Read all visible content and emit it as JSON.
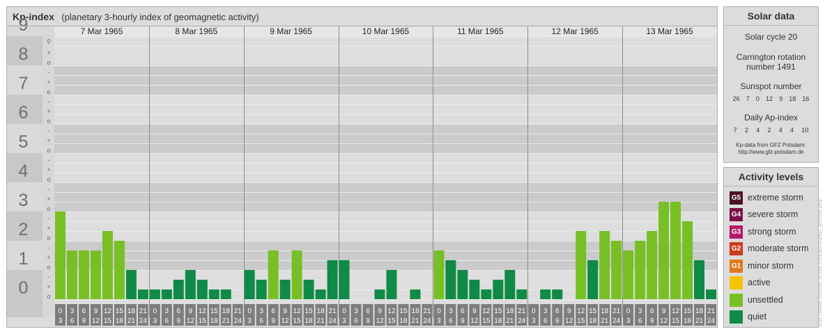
{
  "header": {
    "title": "Kp-index",
    "subtitle": "(planetary 3-hourly index of geomagnetic activity)"
  },
  "chart_data": {
    "type": "bar",
    "y_levels": [
      "0",
      "1",
      "2",
      "3",
      "4",
      "5",
      "6",
      "7",
      "8",
      "9"
    ],
    "y_minor": [
      "o",
      "+",
      "-"
    ],
    "ylim": [
      0,
      9
    ],
    "days": [
      {
        "date": "7 Mar 1965",
        "kp": [
          3.0,
          1.667,
          1.667,
          1.667,
          2.333,
          2.0,
          1.0,
          0.333
        ]
      },
      {
        "date": "8 Mar 1965",
        "kp": [
          0.333,
          0.333,
          0.667,
          1.0,
          0.667,
          0.333,
          0.333,
          0.0
        ]
      },
      {
        "date": "9 Mar 1965",
        "kp": [
          1.0,
          0.667,
          1.667,
          0.667,
          1.667,
          0.667,
          0.333,
          1.333
        ]
      },
      {
        "date": "10 Mar 1965",
        "kp": [
          1.333,
          0.0,
          0.0,
          0.333,
          1.0,
          0.0,
          0.333,
          0.0
        ]
      },
      {
        "date": "11 Mar 1965",
        "kp": [
          1.667,
          1.333,
          1.0,
          0.667,
          0.333,
          0.667,
          1.0,
          0.333
        ]
      },
      {
        "date": "12 Mar 1965",
        "kp": [
          0.0,
          0.333,
          0.333,
          0.0,
          2.333,
          1.333,
          2.333,
          2.0
        ]
      },
      {
        "date": "13 Mar 1965",
        "kp": [
          1.667,
          2.0,
          2.333,
          3.333,
          3.333,
          2.667,
          1.333,
          0.333
        ]
      }
    ],
    "slot_labels": [
      [
        "0",
        "3"
      ],
      [
        "3",
        "6"
      ],
      [
        "6",
        "9"
      ],
      [
        "9",
        "12"
      ],
      [
        "12",
        "15"
      ],
      [
        "15",
        "18"
      ],
      [
        "18",
        "21"
      ],
      [
        "21",
        "24"
      ]
    ],
    "thresholds": {
      "unsettled": 1.667,
      "active": 4
    }
  },
  "solar_data": {
    "heading": "Solar data",
    "cycle": "Solar cycle 20",
    "carrington_1": "Carrington rotation",
    "carrington_2": "number 1491",
    "sunspot_heading": "Sunspot number",
    "sunspot_values": [
      "26",
      "7",
      "0",
      "12",
      "9",
      "18",
      "16"
    ],
    "ap_heading": "Daily Ap-index",
    "ap_values": [
      "7",
      "2",
      "4",
      "2",
      "4",
      "4",
      "10"
    ],
    "source_1": "Kp-data from GFZ Potsdam:",
    "source_2": "http://www.gfz-potsdam.de"
  },
  "activity_levels": {
    "heading": "Activity levels",
    "items": [
      {
        "code": "G5",
        "label": "extreme storm",
        "color": "#4a0f2a"
      },
      {
        "code": "G4",
        "label": "severe storm",
        "color": "#7a1048"
      },
      {
        "code": "G3",
        "label": "strong storm",
        "color": "#b51a6a"
      },
      {
        "code": "G2",
        "label": "moderate storm",
        "color": "#d03a1a"
      },
      {
        "code": "G1",
        "label": "minor storm",
        "color": "#e07a1a"
      },
      {
        "code": "",
        "label": "active",
        "color": "#f7c200"
      },
      {
        "code": "",
        "label": "unsettled",
        "color": "#78bf26"
      },
      {
        "code": "",
        "label": "quiet",
        "color": "#0f8a47"
      }
    ]
  },
  "credit": "http://www.fheuser-eufex.info/aurora/kp_archive.php"
}
